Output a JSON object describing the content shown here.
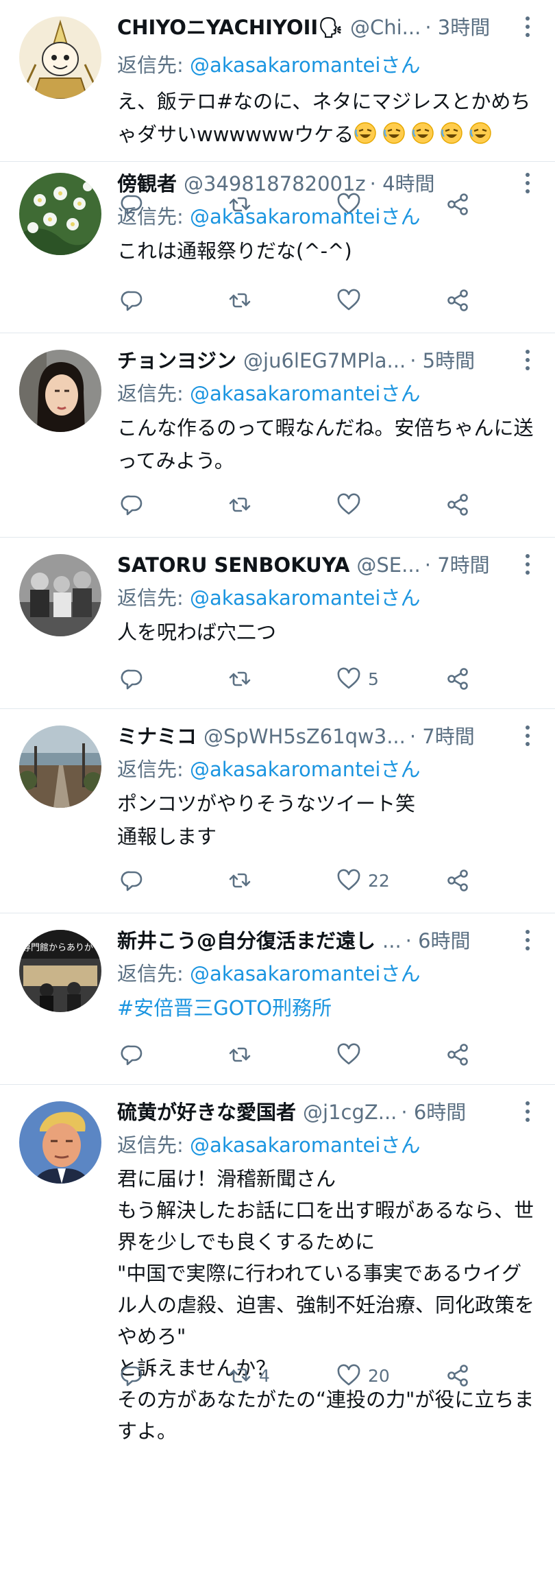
{
  "tweets": [
    {
      "name": "CHIYOニYACHIYOII🗣",
      "handle": "@Chi...",
      "time": "· 3時間",
      "reply_prefix": "返信先: ",
      "reply_handle": "@akasakaromanteiさん",
      "text": "え、飯テロ#なのに、ネタにマジレスとかめちゃダサいwwwwwwウケる",
      "emoji": [
        "rofl-emoji",
        "rofl-emoji",
        "rofl-emoji",
        "rofl-emoji",
        "rofl-emoji"
      ],
      "retweets": "",
      "likes": "",
      "avatar": "warrior-illustration-avatar"
    },
    {
      "name": "傍観者",
      "handle": "@349818782001z",
      "time": "· 4時間",
      "reply_prefix": "返信先: ",
      "reply_handle": "@akasakaromanteiさん",
      "text": "これは通報祭りだな(^-^)",
      "retweets": "",
      "likes": "",
      "avatar": "white-flowers-avatar"
    },
    {
      "name": "チョンヨジン",
      "handle": "@ju6lEG7MPla...",
      "time": "· 5時間",
      "reply_prefix": "返信先: ",
      "reply_handle": "@akasakaromanteiさん",
      "text": "こんな作るのって暇なんだね。安倍ちゃんに送ってみよう。",
      "retweets": "",
      "likes": "",
      "avatar": "woman-portrait-avatar"
    },
    {
      "name": "SATORU SENBOKUYA",
      "handle": "@SE...",
      "time": "· 7時間",
      "reply_prefix": "返信先: ",
      "reply_handle": "@akasakaromanteiさん",
      "text": "人を呪わば穴二つ",
      "retweets": "",
      "likes": "5",
      "avatar": "bw-group-photo-avatar"
    },
    {
      "name": "ミナミコ",
      "handle": "@SpWH5sZ61qw3...",
      "time": "· 7時間",
      "reply_prefix": "返信先: ",
      "reply_handle": "@akasakaromanteiさん",
      "text": "ポンコツがやりそうなツイート笑\n通報します",
      "retweets": "",
      "likes": "22",
      "avatar": "hill-street-avatar"
    },
    {
      "name": "新井こう@自分復活まだ遠し",
      "handle": "...",
      "time": "· 6時間",
      "reply_prefix": "返信先: ",
      "reply_handle": "@akasakaromanteiさん",
      "text": "#安倍晋三GOTO刑務所",
      "retweets": "",
      "likes": "",
      "avatar": "protest-photo-avatar",
      "avatar_text": "専門館からありが"
    },
    {
      "name": "硫黄が好きな愛国者",
      "handle": "@j1cgZ...",
      "time": "· 6時間",
      "reply_prefix": "返信先: ",
      "reply_handle": "@akasakaromanteiさん",
      "text": "君に届け！滑稽新聞さん\nもう解決したお話に口を出す暇があるなら、世界を少しでも良くするために\n\"中国で実際に行われている事実であるウイグル人の虐殺、迫害、強制不妊治療、同化政策をやめろ\"\nと訴えませんか？\nその方があなたがたの“連投の力\"が役に立ちますよ。",
      "retweets": "4",
      "likes": "20",
      "avatar": "man-portrait-avatar"
    }
  ],
  "colors": {
    "name": "#0f1419",
    "muted": "#5b7083",
    "link": "#1b95e0",
    "divider": "#e1e8ed"
  },
  "icons": [
    "reply-icon",
    "retweet-icon",
    "like-icon",
    "share-icon",
    "more-icon"
  ]
}
